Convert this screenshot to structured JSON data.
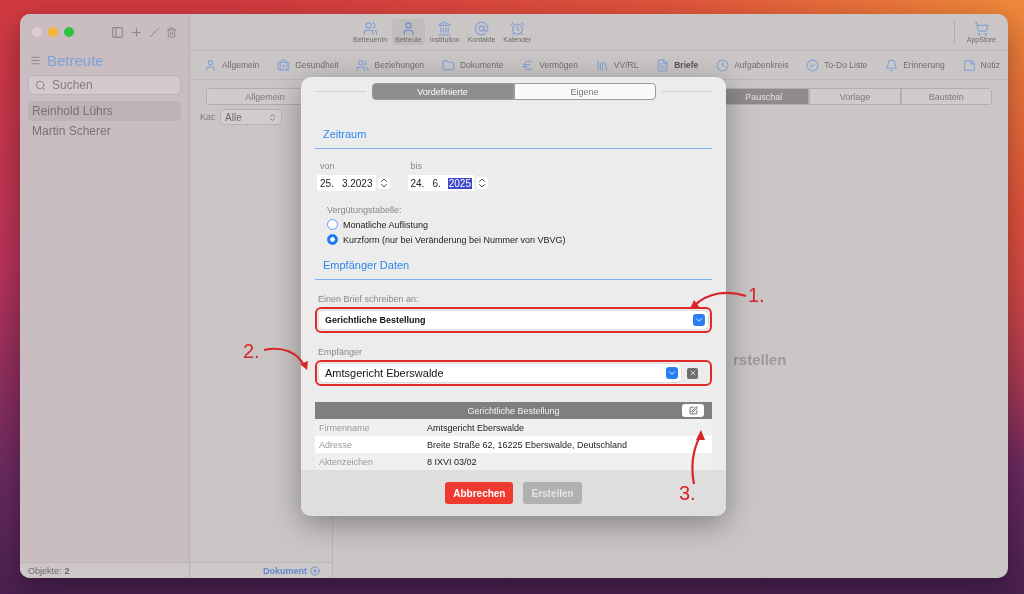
{
  "sidebar": {
    "title": "Betreute",
    "search": {
      "placeholder": "Suchen"
    },
    "items": [
      {
        "label": "Reinhold Lührs",
        "selected": true
      },
      {
        "label": "Martin Scherer",
        "selected": false
      }
    ],
    "footer_label": "Objekte:",
    "footer_count": "2"
  },
  "toolbar": {
    "tabs": [
      {
        "label": "Betreuer/in",
        "selected": false
      },
      {
        "label": "Betreute",
        "selected": true
      },
      {
        "label": "Institution",
        "selected": false
      },
      {
        "label": "Kontakte",
        "selected": false
      },
      {
        "label": "Kalender",
        "selected": false
      }
    ],
    "store": "AppStore"
  },
  "sections": [
    {
      "label": "Allgemein",
      "selected": false
    },
    {
      "label": "Gesundheit",
      "selected": false
    },
    {
      "label": "Beziehungen",
      "selected": false
    },
    {
      "label": "Dokumente",
      "selected": false
    },
    {
      "label": "Vermögen",
      "selected": false
    },
    {
      "label": "VV/RL",
      "selected": false
    },
    {
      "label": "Briefe",
      "selected": true
    },
    {
      "label": "Aufgabenkreis",
      "selected": false
    },
    {
      "label": "To-Do Liste",
      "selected": false
    },
    {
      "label": "Erinnerung",
      "selected": false
    },
    {
      "label": "Notiz",
      "selected": false
    }
  ],
  "list_column": {
    "segment": "Allgemein",
    "filter_label": "Kat:",
    "filter_value": "Alle",
    "add_label": "Dokument"
  },
  "content": {
    "segments": [
      {
        "label": "Pauschal",
        "selected": true
      },
      {
        "label": "Vorlage",
        "selected": false
      },
      {
        "label": "Baustein",
        "selected": false
      }
    ],
    "hint": "rstellen"
  },
  "dialog": {
    "tabs": [
      {
        "label": "Vordefinierte",
        "selected": true
      },
      {
        "label": "Eigene",
        "selected": false
      }
    ],
    "period_heading": "Zeitraum",
    "dates": [
      {
        "label": "von",
        "parts": [
          {
            "text": "25.",
            "selected": false
          },
          {
            "text": "3.2023",
            "selected": false
          }
        ]
      },
      {
        "label": "bis",
        "parts": [
          {
            "text": "24.",
            "selected": false
          },
          {
            "text": "6.",
            "selected": false
          },
          {
            "text": "2025",
            "selected": true
          }
        ]
      }
    ],
    "table_label": "Vergütungstabelle:",
    "options": [
      {
        "label": "Monatliche Auflistung",
        "selected": false
      },
      {
        "label": "Kurzform (nur bei Veränderung bei Nummer von VBVG)",
        "selected": true
      }
    ],
    "recipient_heading": "Empfänger Daten",
    "selects": [
      {
        "label": "Einen Brief schreiben an:",
        "value": "Gerichtliche Bestellung",
        "highlighted": true,
        "clearable": false,
        "bold": true
      },
      {
        "label": "Empfänger",
        "value": "Amtsgericht Eberswalde",
        "highlighted": true,
        "clearable": true,
        "bold": false
      }
    ],
    "details": {
      "title": "Gerichtliche Bestellung",
      "rows": [
        {
          "label": "Firmenname",
          "value": "Amtsgericht Eberswalde"
        },
        {
          "label": "Adresse",
          "value": "Breite Straße 62, 16225 Eberswalde, Deutschland"
        },
        {
          "label": "Aktenzeichen",
          "value": "8 IXVI 03/02"
        }
      ]
    },
    "buttons": [
      {
        "label": "Abbrechen",
        "disabled": false
      },
      {
        "label": "Erstellen",
        "disabled": true
      }
    ]
  },
  "annotations": [
    {
      "label": "1."
    },
    {
      "label": "2."
    },
    {
      "label": "3."
    }
  ]
}
